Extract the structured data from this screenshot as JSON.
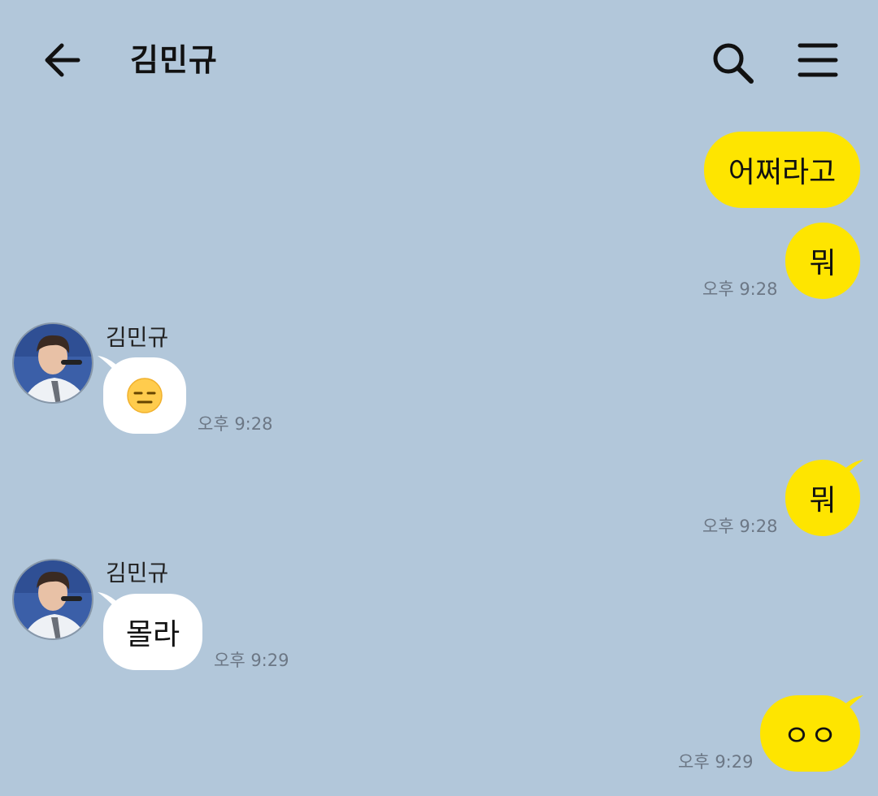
{
  "header": {
    "title": "김민규",
    "back_icon": "arrow-left-icon",
    "search_icon": "search-icon",
    "menu_icon": "menu-icon"
  },
  "colors": {
    "background": "#b2c7da",
    "my_bubble": "#fee500",
    "their_bubble": "#ffffff",
    "timestamp": "#6c7785"
  },
  "messages": [
    {
      "sender": "me",
      "text": "어쩌라고",
      "time": ""
    },
    {
      "sender": "me",
      "text": "뭐",
      "time": "오후 9:28"
    },
    {
      "sender": "them",
      "name": "김민규",
      "text": "",
      "emoji": "expressionless-face-icon",
      "time": "오후 9:28"
    },
    {
      "sender": "me",
      "text": "뭐",
      "time": "오후 9:28"
    },
    {
      "sender": "them",
      "name": "김민규",
      "text": "몰라",
      "time": "오후 9:29"
    },
    {
      "sender": "me",
      "text": "ㅇㅇ",
      "time": "오후 9:29"
    }
  ]
}
